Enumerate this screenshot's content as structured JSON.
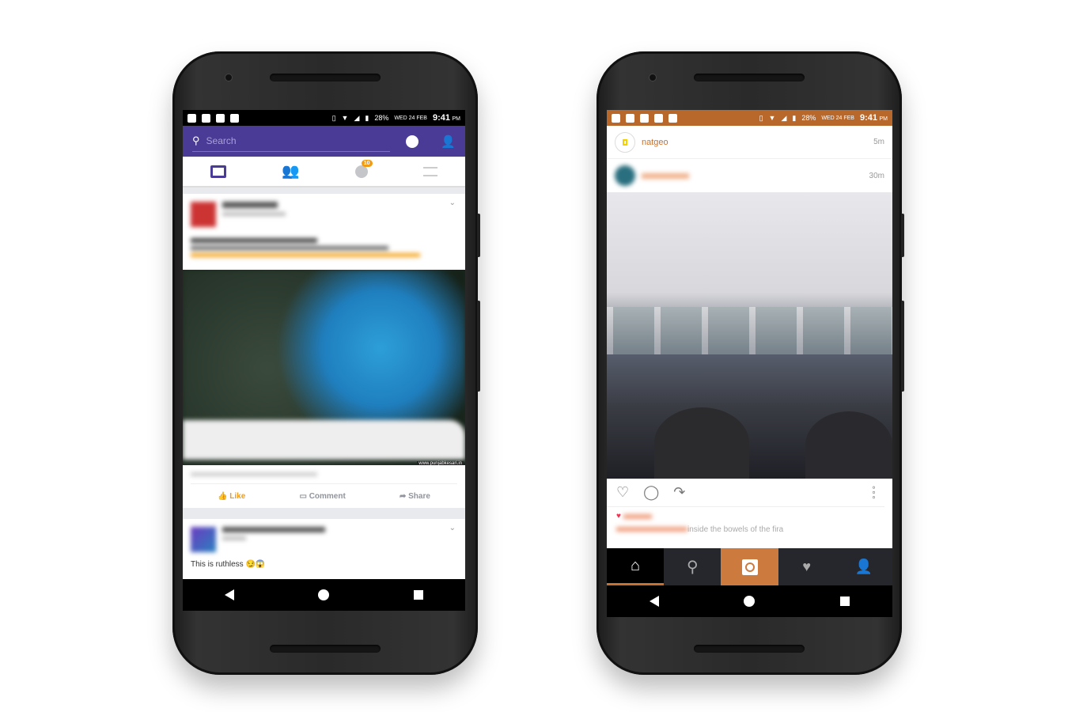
{
  "status_bar": {
    "battery": "28%",
    "date": "WED 24 FEB",
    "time": "9:41",
    "ampm": "PM"
  },
  "fb": {
    "accent": "#4a3b96",
    "search_placeholder": "Search",
    "notification_count": "10",
    "tabs": [
      "news-feed",
      "friends",
      "notifications",
      "menu"
    ],
    "post1": {
      "link_source": "www.punjabkesari.in",
      "actions": {
        "like": "Like",
        "comment": "Comment",
        "share": "Share"
      }
    },
    "post2": {
      "text": "This is ruthless 😏😱"
    }
  },
  "ig": {
    "accent": "#c8702e",
    "post_top": {
      "username": "natgeo",
      "time": "5m"
    },
    "post_main": {
      "time": "30m",
      "caption": "inside the bowels of the fira"
    },
    "bottom_nav": [
      "home",
      "search",
      "camera",
      "activity",
      "profile"
    ]
  }
}
